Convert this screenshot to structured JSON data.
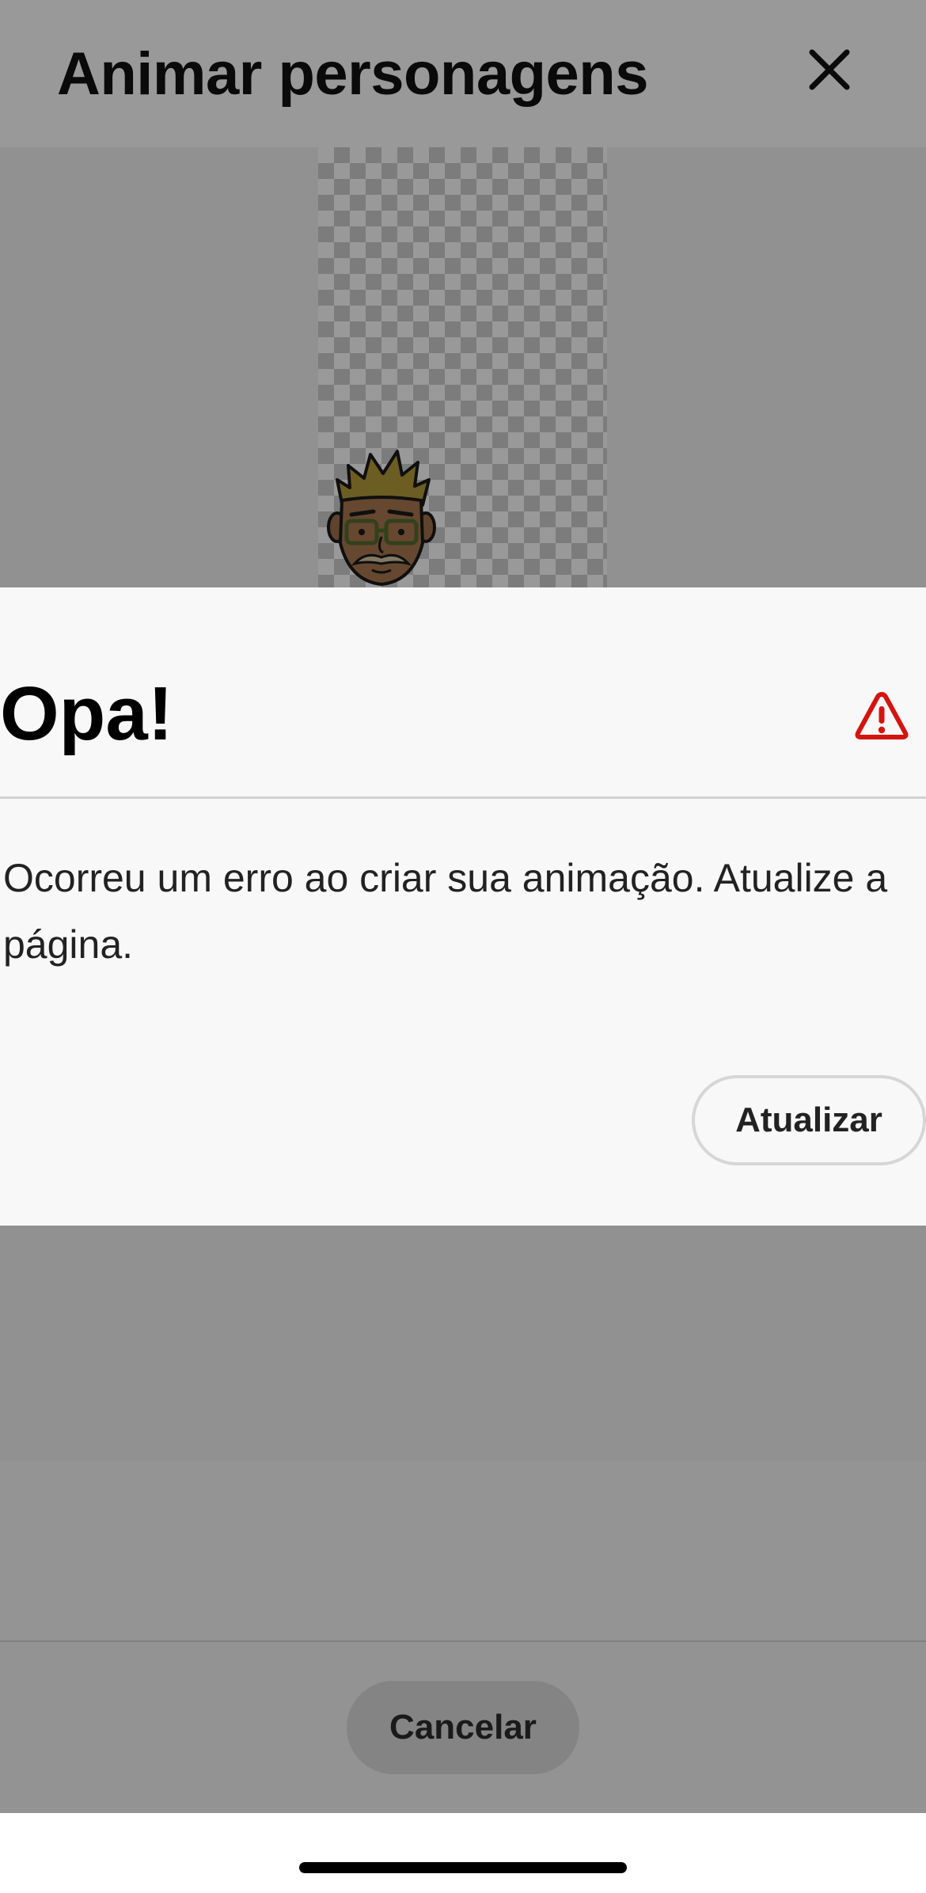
{
  "app": {
    "title": "Animar personagens",
    "close_icon": "close-icon",
    "cancel_label": "Cancelar"
  },
  "dialog": {
    "title": "Opa!",
    "icon": "warning-icon",
    "message": "Ocorreu um erro ao criar sua animação. Atualize a página.",
    "refresh_label": "Atualizar"
  },
  "colors": {
    "warning": "#d31510",
    "scrim": "rgba(0,0,0,0.40)",
    "dialog_bg": "#f8f8f8"
  }
}
